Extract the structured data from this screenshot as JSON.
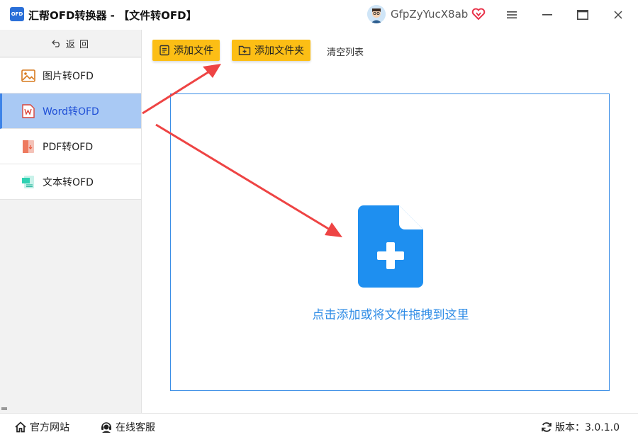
{
  "window": {
    "logo_text": "OFD",
    "title": "汇帮OFD转换器 - 【文件转OFD】",
    "username": "GfpZyYucX8ab"
  },
  "sidebar": {
    "back_label": "返 回",
    "items": [
      {
        "label": "图片转OFD",
        "icon": "image-icon",
        "active": false
      },
      {
        "label": "Word转OFD",
        "icon": "word-icon",
        "active": true
      },
      {
        "label": "PDF转OFD",
        "icon": "pdf-icon",
        "active": false
      },
      {
        "label": "文本转OFD",
        "icon": "text-file-icon",
        "active": false
      }
    ]
  },
  "toolbar": {
    "add_file_label": "添加文件",
    "add_folder_label": "添加文件夹",
    "clear_list_label": "清空列表"
  },
  "dropzone": {
    "hint": "点击添加或将文件拖拽到这里"
  },
  "footer": {
    "website_label": "官方网站",
    "support_label": "在线客服",
    "version_label": "版本：3.0.1.0"
  },
  "colors": {
    "accent_blue": "#2f8ce6",
    "button_yellow": "#fcbe15",
    "active_nav": "#a9c9f4",
    "annotation_red": "#ee4444"
  }
}
